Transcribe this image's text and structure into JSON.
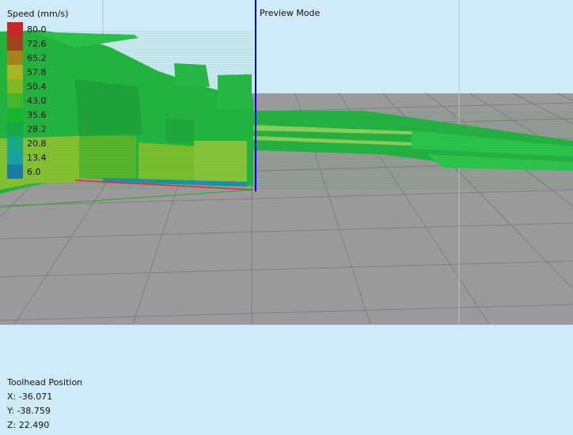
{
  "legend": {
    "title": "Speed (mm/s)",
    "items": [
      {
        "value": "80.0",
        "color": "#c8262a"
      },
      {
        "value": "72.6",
        "color": "#a2421a"
      },
      {
        "value": "65.2",
        "color": "#a2851a"
      },
      {
        "value": "57.8",
        "color": "#a7b524"
      },
      {
        "value": "50.4",
        "color": "#84b726"
      },
      {
        "value": "43.0",
        "color": "#48b62a"
      },
      {
        "value": "35.6",
        "color": "#1ab52e"
      },
      {
        "value": "28.2",
        "color": "#17a746"
      },
      {
        "value": "20.8",
        "color": "#16a983"
      },
      {
        "value": "13.4",
        "color": "#17a1a1"
      },
      {
        "value": "6.0",
        "color": "#1c78a6"
      }
    ]
  },
  "viewport": {
    "mode_label": "Preview Mode",
    "bed_color": "#9a9a9a",
    "background_color": "#cfeaf8",
    "toolhead_marker_color": "#0000ee"
  },
  "toolhead": {
    "heading": "Toolhead Position",
    "x": "X: -36.071",
    "y": "Y: -38.759",
    "z": "Z: 22.490"
  }
}
